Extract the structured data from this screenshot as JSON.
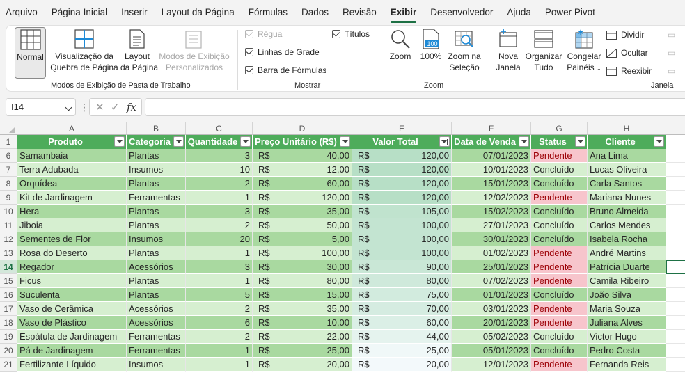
{
  "menu": [
    "Arquivo",
    "Página Inicial",
    "Inserir",
    "Layout da Página",
    "Fórmulas",
    "Dados",
    "Revisão",
    "Exibir",
    "Desenvolvedor",
    "Ajuda",
    "Power Pivot"
  ],
  "menu_active": "Exibir",
  "ribbon": {
    "views": {
      "normal": "Normal",
      "page_break_1": "Visualização da",
      "page_break_2": "Quebra de Página",
      "page_layout_1": "Layout",
      "page_layout_2": "da Página",
      "custom_1": "Modos de Exibição",
      "custom_2": "Personalizados",
      "group": "Modos de Exibição de Pasta de Trabalho"
    },
    "show": {
      "ruler": "Régua",
      "gridlines": "Linhas de Grade",
      "formula_bar": "Barra de Fórmulas",
      "headings": "Títulos",
      "group": "Mostrar"
    },
    "zoom": {
      "zoom": "Zoom",
      "hundred": "100%",
      "hundred_icon_text": "100",
      "to_selection_1": "Zoom na",
      "to_selection_2": "Seleção",
      "group": "Zoom"
    },
    "window": {
      "new_1": "Nova",
      "new_2": "Janela",
      "arrange_1": "Organizar",
      "arrange_2": "Tudo",
      "freeze_1": "Congelar",
      "freeze_2": "Painéis",
      "split": "Dividir",
      "hide": "Ocultar",
      "unhide": "Reexibir",
      "group": "Janela",
      "accent_color": "#1e8ad6"
    }
  },
  "formula_bar": {
    "name_box": "I14",
    "fx": "fx",
    "cancel": "✕",
    "enter": "✓",
    "more": "⋮"
  },
  "columns": [
    "A",
    "B",
    "C",
    "D",
    "E",
    "F",
    "G",
    "H"
  ],
  "headers": [
    "Produto",
    "Categoria",
    "Quantidade",
    "Preço Unitário (R$)",
    "Valor Total",
    "Data de Venda",
    "Status",
    "Cliente"
  ],
  "header_row_number": "1",
  "currency": "R$",
  "rows": [
    {
      "n": "6",
      "produto": "Samambaia",
      "categoria": "Plantas",
      "qtd": "3",
      "preco": "40,00",
      "total": "120,00",
      "data": "07/01/2023",
      "status": "Pendente",
      "cliente": "Ana Lima"
    },
    {
      "n": "7",
      "produto": "Terra Adubada",
      "categoria": "Insumos",
      "qtd": "10",
      "preco": "12,00",
      "total": "120,00",
      "data": "10/01/2023",
      "status": "Concluído",
      "cliente": "Lucas Oliveira"
    },
    {
      "n": "8",
      "produto": "Orquídea",
      "categoria": "Plantas",
      "qtd": "2",
      "preco": "60,00",
      "total": "120,00",
      "data": "15/01/2023",
      "status": "Concluído",
      "cliente": "Carla Santos"
    },
    {
      "n": "9",
      "produto": "Kit de Jardinagem",
      "categoria": "Ferramentas",
      "qtd": "1",
      "preco": "120,00",
      "total": "120,00",
      "data": "12/02/2023",
      "status": "Pendente",
      "cliente": "Mariana Nunes"
    },
    {
      "n": "10",
      "produto": "Hera",
      "categoria": "Plantas",
      "qtd": "3",
      "preco": "35,00",
      "total": "105,00",
      "data": "15/02/2023",
      "status": "Concluído",
      "cliente": "Bruno Almeida"
    },
    {
      "n": "11",
      "produto": "Jiboia",
      "categoria": "Plantas",
      "qtd": "2",
      "preco": "50,00",
      "total": "100,00",
      "data": "27/01/2023",
      "status": "Concluído",
      "cliente": "Carlos Mendes"
    },
    {
      "n": "12",
      "produto": "Sementes de Flor",
      "categoria": "Insumos",
      "qtd": "20",
      "preco": "5,00",
      "total": "100,00",
      "data": "30/01/2023",
      "status": "Concluído",
      "cliente": "Isabela Rocha"
    },
    {
      "n": "13",
      "produto": "Rosa do Deserto",
      "categoria": "Plantas",
      "qtd": "1",
      "preco": "100,00",
      "total": "100,00",
      "data": "01/02/2023",
      "status": "Pendente",
      "cliente": "André Martins"
    },
    {
      "n": "14",
      "produto": "Regador",
      "categoria": "Acessórios",
      "qtd": "3",
      "preco": "30,00",
      "total": "90,00",
      "data": "25/01/2023",
      "status": "Pendente",
      "cliente": "Patrícia Duarte"
    },
    {
      "n": "15",
      "produto": "Ficus",
      "categoria": "Plantas",
      "qtd": "1",
      "preco": "80,00",
      "total": "80,00",
      "data": "07/02/2023",
      "status": "Pendente",
      "cliente": "Camila Ribeiro"
    },
    {
      "n": "16",
      "produto": "Suculenta",
      "categoria": "Plantas",
      "qtd": "5",
      "preco": "15,00",
      "total": "75,00",
      "data": "01/01/2023",
      "status": "Concluído",
      "cliente": "João Silva"
    },
    {
      "n": "17",
      "produto": "Vaso de Cerâmica",
      "categoria": "Acessórios",
      "qtd": "2",
      "preco": "35,00",
      "total": "70,00",
      "data": "03/01/2023",
      "status": "Pendente",
      "cliente": "Maria Souza"
    },
    {
      "n": "18",
      "produto": "Vaso de Plástico",
      "categoria": "Acessórios",
      "qtd": "6",
      "preco": "10,00",
      "total": "60,00",
      "data": "20/01/2023",
      "status": "Pendente",
      "cliente": "Juliana Alves"
    },
    {
      "n": "19",
      "produto": "Espátula de Jardinagem",
      "categoria": "Ferramentas",
      "qtd": "2",
      "preco": "22,00",
      "total": "44,00",
      "data": "05/02/2023",
      "status": "Concluído",
      "cliente": "Victor Hugo"
    },
    {
      "n": "20",
      "produto": "Pá de Jardinagem",
      "categoria": "Ferramentas",
      "qtd": "1",
      "preco": "25,00",
      "total": "25,00",
      "data": "05/01/2023",
      "status": "Concluído",
      "cliente": "Pedro Costa"
    },
    {
      "n": "21",
      "produto": "Fertilizante Líquido",
      "categoria": "Insumos",
      "qtd": "1",
      "preco": "20,00",
      "total": "20,00",
      "data": "12/01/2023",
      "status": "Pendente",
      "cliente": "Fernanda Reis"
    }
  ],
  "colors": {
    "table_header": "#4eac5b",
    "band_dark": "#a9d9a0",
    "band_light": "#d6efd0",
    "pending_fill": "#f7c5cc",
    "pending_text": "#9c0006",
    "total_scale_max": "#b7dfc6",
    "total_scale_min": "#f3f9fb",
    "accent": "#1e7145"
  }
}
